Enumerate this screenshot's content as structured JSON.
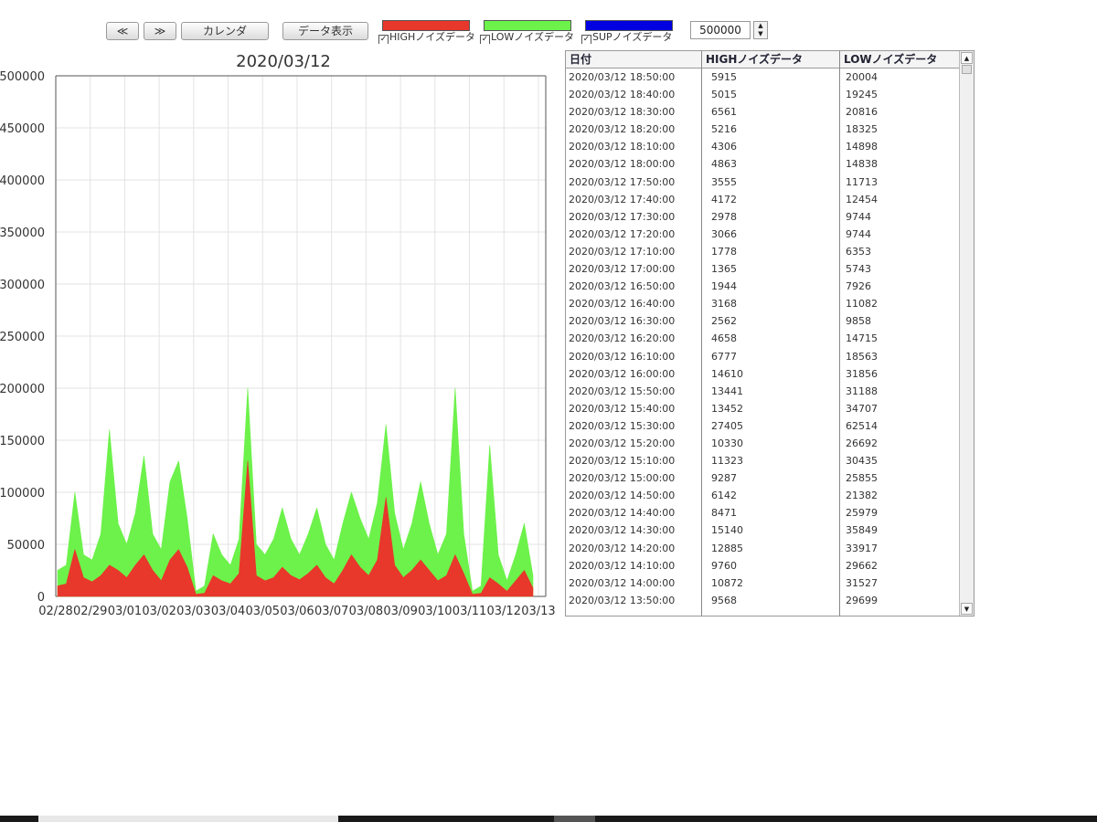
{
  "toolbar": {
    "prev_label": "≪",
    "next_label": "≫",
    "calendar_label": "カレンダ",
    "show_data_label": "データ表示",
    "spin_value": "500000"
  },
  "legend": [
    {
      "color": "#e8372b",
      "label": "HIGHノイズデータ",
      "check": "✓"
    },
    {
      "color": "#6cf24a",
      "label": "LOWノイズデータ",
      "check": "✓"
    },
    {
      "color": "#0000e0",
      "label": "SUPノイズデータ",
      "check": "✓"
    }
  ],
  "chart_data": {
    "type": "area",
    "title": "2020/03/12",
    "xlabel": "",
    "ylabel": "",
    "ylim": [
      0,
      500000
    ],
    "yticks": [
      0,
      50000,
      100000,
      150000,
      200000,
      250000,
      300000,
      350000,
      400000,
      450000,
      500000
    ],
    "xticks": [
      "02/28",
      "02/29",
      "03/01",
      "03/02",
      "03/03",
      "03/04",
      "03/05",
      "03/06",
      "03/07",
      "03/08",
      "03/09",
      "03/10",
      "03/11",
      "03/12",
      "03/13"
    ],
    "grid": true,
    "legend": "none",
    "series": [
      {
        "name": "HIGHノイズデータ",
        "color": "#e8372b",
        "x": [
          "02/28 00:00",
          "02/28 06:00",
          "02/28 12:00",
          "02/28 18:00",
          "02/29 00:00",
          "02/29 06:00",
          "02/29 12:00",
          "02/29 18:00",
          "03/01 00:00",
          "03/01 06:00",
          "03/01 12:00",
          "03/01 18:00",
          "03/02 00:00",
          "03/02 06:00",
          "03/02 12:00",
          "03/02 18:00",
          "03/03 00:00",
          "03/03 06:00",
          "03/03 12:00",
          "03/03 18:00",
          "03/04 00:00",
          "03/04 06:00",
          "03/04 12:00",
          "03/04 18:00",
          "03/05 00:00",
          "03/05 06:00",
          "03/05 12:00",
          "03/05 18:00",
          "03/06 00:00",
          "03/06 06:00",
          "03/06 12:00",
          "03/06 18:00",
          "03/07 00:00",
          "03/07 06:00",
          "03/07 12:00",
          "03/07 18:00",
          "03/08 00:00",
          "03/08 06:00",
          "03/08 12:00",
          "03/08 18:00",
          "03/09 00:00",
          "03/09 06:00",
          "03/09 12:00",
          "03/09 18:00",
          "03/10 00:00",
          "03/10 06:00",
          "03/10 12:00",
          "03/10 18:00",
          "03/11 00:00",
          "03/11 06:00",
          "03/11 12:00",
          "03/11 18:00",
          "03/12 00:00",
          "03/12 06:00",
          "03/12 12:00",
          "03/12 18:00"
        ],
        "values": [
          10000,
          12000,
          45000,
          18000,
          14000,
          20000,
          30000,
          25000,
          18000,
          30000,
          40000,
          25000,
          15000,
          35000,
          45000,
          28000,
          2000,
          3000,
          20000,
          15000,
          12000,
          22000,
          130000,
          20000,
          15000,
          18000,
          28000,
          20000,
          16000,
          22000,
          30000,
          18000,
          12000,
          25000,
          40000,
          28000,
          20000,
          35000,
          95000,
          30000,
          18000,
          25000,
          35000,
          25000,
          15000,
          20000,
          40000,
          22000,
          2000,
          3000,
          18000,
          12000,
          5000,
          15000,
          25000,
          8000
        ]
      },
      {
        "name": "LOWノイズデータ",
        "color": "#6cf24a",
        "x": [
          "02/28 00:00",
          "02/28 06:00",
          "02/28 12:00",
          "02/28 18:00",
          "02/29 00:00",
          "02/29 06:00",
          "02/29 12:00",
          "02/29 18:00",
          "03/01 00:00",
          "03/01 06:00",
          "03/01 12:00",
          "03/01 18:00",
          "03/02 00:00",
          "03/02 06:00",
          "03/02 12:00",
          "03/02 18:00",
          "03/03 00:00",
          "03/03 06:00",
          "03/03 12:00",
          "03/03 18:00",
          "03/04 00:00",
          "03/04 06:00",
          "03/04 12:00",
          "03/04 18:00",
          "03/05 00:00",
          "03/05 06:00",
          "03/05 12:00",
          "03/05 18:00",
          "03/06 00:00",
          "03/06 06:00",
          "03/06 12:00",
          "03/06 18:00",
          "03/07 00:00",
          "03/07 06:00",
          "03/07 12:00",
          "03/07 18:00",
          "03/08 00:00",
          "03/08 06:00",
          "03/08 12:00",
          "03/08 18:00",
          "03/09 00:00",
          "03/09 06:00",
          "03/09 12:00",
          "03/09 18:00",
          "03/10 00:00",
          "03/10 06:00",
          "03/10 12:00",
          "03/10 18:00",
          "03/11 00:00",
          "03/11 06:00",
          "03/11 12:00",
          "03/11 18:00",
          "03/12 00:00",
          "03/12 06:00",
          "03/12 12:00",
          "03/12 18:00"
        ],
        "values": [
          25000,
          30000,
          100000,
          40000,
          35000,
          60000,
          160000,
          70000,
          50000,
          80000,
          135000,
          60000,
          45000,
          110000,
          130000,
          75000,
          5000,
          10000,
          60000,
          40000,
          30000,
          55000,
          200000,
          50000,
          40000,
          55000,
          85000,
          55000,
          40000,
          60000,
          85000,
          50000,
          35000,
          70000,
          100000,
          75000,
          55000,
          90000,
          165000,
          80000,
          45000,
          70000,
          110000,
          70000,
          40000,
          60000,
          200000,
          60000,
          5000,
          10000,
          145000,
          40000,
          15000,
          40000,
          70000,
          20000
        ]
      }
    ]
  },
  "table": {
    "headers": [
      "日付",
      "HIGHノイズデータ",
      "LOWノイズデータ"
    ],
    "rows": [
      [
        "2020/03/12 18:50:00",
        "5915",
        "20004"
      ],
      [
        "2020/03/12 18:40:00",
        "5015",
        "19245"
      ],
      [
        "2020/03/12 18:30:00",
        "6561",
        "20816"
      ],
      [
        "2020/03/12 18:20:00",
        "5216",
        "18325"
      ],
      [
        "2020/03/12 18:10:00",
        "4306",
        "14898"
      ],
      [
        "2020/03/12 18:00:00",
        "4863",
        "14838"
      ],
      [
        "2020/03/12 17:50:00",
        "3555",
        "11713"
      ],
      [
        "2020/03/12 17:40:00",
        "4172",
        "12454"
      ],
      [
        "2020/03/12 17:30:00",
        "2978",
        "9744"
      ],
      [
        "2020/03/12 17:20:00",
        "3066",
        "9744"
      ],
      [
        "2020/03/12 17:10:00",
        "1778",
        "6353"
      ],
      [
        "2020/03/12 17:00:00",
        "1365",
        "5743"
      ],
      [
        "2020/03/12 16:50:00",
        "1944",
        "7926"
      ],
      [
        "2020/03/12 16:40:00",
        "3168",
        "11082"
      ],
      [
        "2020/03/12 16:30:00",
        "2562",
        "9858"
      ],
      [
        "2020/03/12 16:20:00",
        "4658",
        "14715"
      ],
      [
        "2020/03/12 16:10:00",
        "6777",
        "18563"
      ],
      [
        "2020/03/12 16:00:00",
        "14610",
        "31856"
      ],
      [
        "2020/03/12 15:50:00",
        "13441",
        "31188"
      ],
      [
        "2020/03/12 15:40:00",
        "13452",
        "34707"
      ],
      [
        "2020/03/12 15:30:00",
        "27405",
        "62514"
      ],
      [
        "2020/03/12 15:20:00",
        "10330",
        "26692"
      ],
      [
        "2020/03/12 15:10:00",
        "11323",
        "30435"
      ],
      [
        "2020/03/12 15:00:00",
        "9287",
        "25855"
      ],
      [
        "2020/03/12 14:50:00",
        "6142",
        "21382"
      ],
      [
        "2020/03/12 14:40:00",
        "8471",
        "25979"
      ],
      [
        "2020/03/12 14:30:00",
        "15140",
        "35849"
      ],
      [
        "2020/03/12 14:20:00",
        "12885",
        "33917"
      ],
      [
        "2020/03/12 14:10:00",
        "9760",
        "29662"
      ],
      [
        "2020/03/12 14:00:00",
        "10872",
        "31527"
      ],
      [
        "2020/03/12 13:50:00",
        "9568",
        "29699"
      ]
    ],
    "scroll_up": "▲",
    "scroll_down": "▼"
  }
}
